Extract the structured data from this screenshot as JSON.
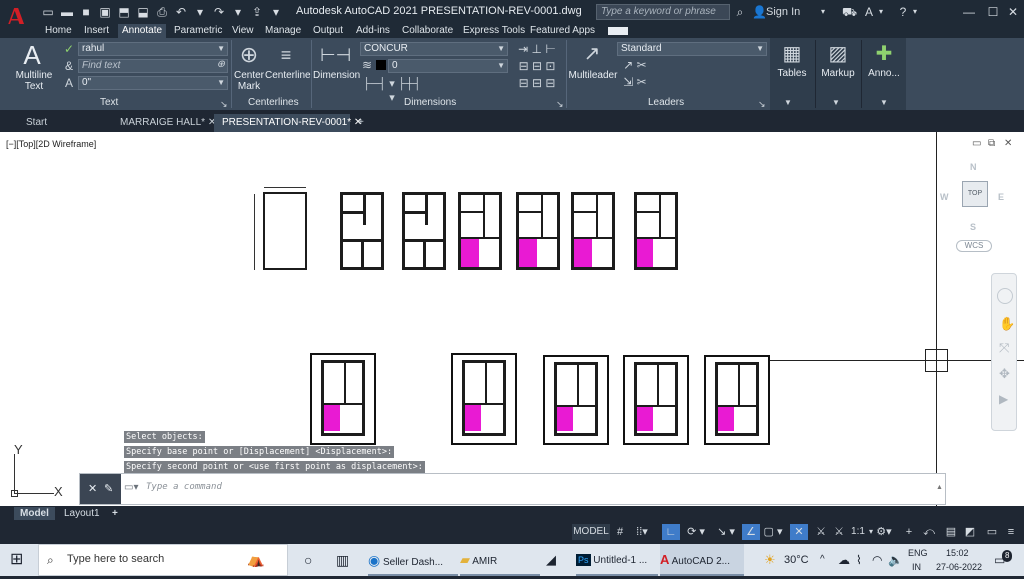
{
  "titlebar": {
    "title": "Autodesk AutoCAD 2021    PRESENTATION-REV-0001.dwg",
    "search_placeholder": "Type a keyword or phrase",
    "sign_in": "Sign In"
  },
  "ribbon_tabs": [
    "Home",
    "Insert",
    "Annotate",
    "Parametric",
    "View",
    "Manage",
    "Output",
    "Add-ins",
    "Collaborate",
    "Express Tools",
    "Featured Apps"
  ],
  "active_tab": "Annotate",
  "ribbon": {
    "text_panel": {
      "multiline_text": "Multiline\nText",
      "style": "rahul",
      "find_placeholder": "Find text",
      "angle": "0\"",
      "label": "Text"
    },
    "centerlines_panel": {
      "center_mark": "Center\nMark",
      "centerline": "Centerline",
      "label": "Centerlines"
    },
    "dimensions_panel": {
      "dimension": "Dimension",
      "style": "CONCUR",
      "layer": "0",
      "label": "Dimensions"
    },
    "leaders_panel": {
      "multileader": "Multileader",
      "style": "Standard",
      "label": "Leaders"
    },
    "tables": "Tables",
    "markup": "Markup",
    "annotation": "Anno..."
  },
  "doc_tabs": [
    "Start",
    "MARRAIGE HALL*",
    "PRESENTATION-REV-0001*"
  ],
  "viewport_label": "[−][Top][2D Wireframe]",
  "navcube": {
    "top": "TOP",
    "n": "N",
    "s": "S",
    "e": "E",
    "w": "W",
    "wcs": "WCS"
  },
  "command_history": [
    "Select objects:",
    "Specify base point or [Displacement] <Displacement>:",
    "Specify second point or <use first point as displacement>:"
  ],
  "command_placeholder": "Type a command",
  "ucs": {
    "x": "X",
    "y": "Y"
  },
  "layout_tabs": [
    "Model",
    "Layout1"
  ],
  "status": {
    "model": "MODEL",
    "scale": "1:1"
  },
  "taskbar": {
    "search_placeholder": "Type here to search",
    "apps": [
      "Seller Dash...",
      "AMIR",
      "Untitled-1 ...",
      "AutoCAD 2..."
    ],
    "weather": "30°C",
    "lang1": "ENG",
    "lang2": "IN",
    "time": "15:02",
    "date": "27-06-2022",
    "notif": "8"
  }
}
